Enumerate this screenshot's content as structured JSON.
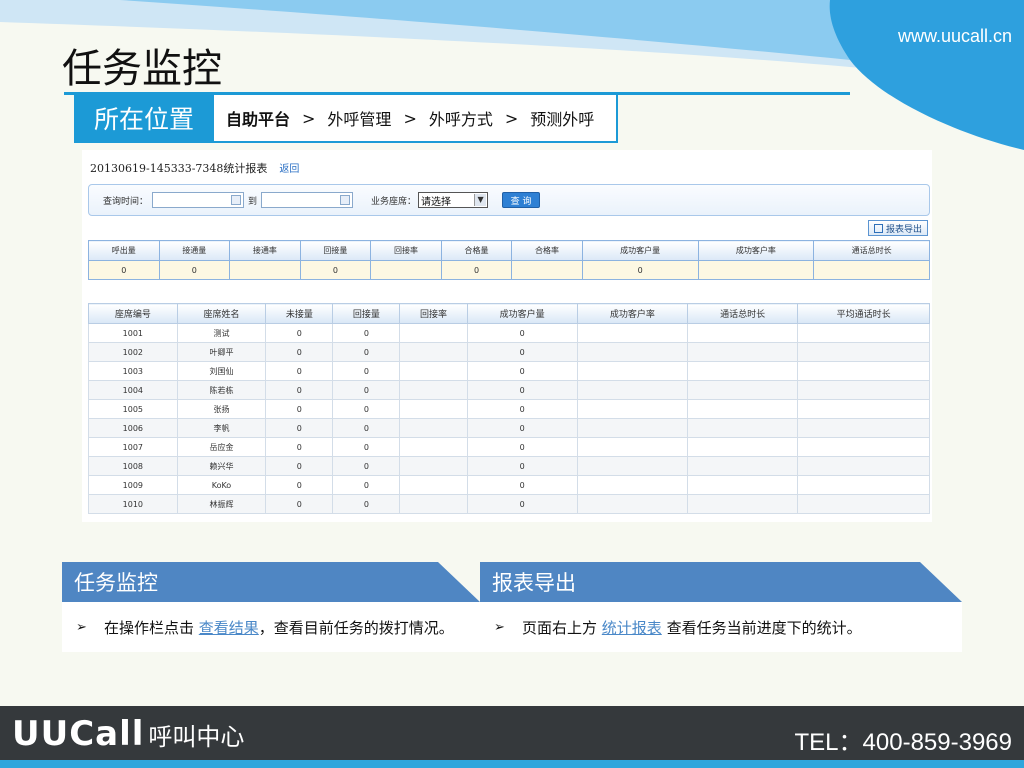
{
  "header": {
    "site_url": "www.uucall.cn",
    "page_title": "任务监控"
  },
  "location": {
    "label": "所在位置",
    "crumbs": [
      "自助平台",
      "外呼管理",
      "外呼方式",
      "预测外呼"
    ],
    "separator": ">"
  },
  "report": {
    "title": "20130619-145333-7348统计报表",
    "back_label": "返回",
    "query": {
      "time_label": "查询时间：",
      "to_label": "到",
      "agent_label": "业务座席：",
      "agent_select": "请选择",
      "query_button": "查 询"
    },
    "export_button": "报表导出",
    "summary": {
      "headers": [
        "呼出量",
        "接通量",
        "接通率",
        "回接量",
        "回接率",
        "合格量",
        "合格率",
        "成功客户量",
        "成功客户率",
        "通话总时长"
      ],
      "row": [
        "0",
        "0",
        "",
        "0",
        "",
        "0",
        "",
        "0",
        "",
        ""
      ]
    },
    "agents": {
      "headers": [
        "座席编号",
        "座席姓名",
        "未接量",
        "回接量",
        "回接率",
        "成功客户量",
        "成功客户率",
        "通话总时长",
        "平均通话时长"
      ],
      "rows": [
        [
          "1001",
          "测试",
          "0",
          "0",
          "",
          "0",
          "",
          "",
          ""
        ],
        [
          "1002",
          "叶卿平",
          "0",
          "0",
          "",
          "0",
          "",
          "",
          ""
        ],
        [
          "1003",
          "刘国仙",
          "0",
          "0",
          "",
          "0",
          "",
          "",
          ""
        ],
        [
          "1004",
          "陈若栋",
          "0",
          "0",
          "",
          "0",
          "",
          "",
          ""
        ],
        [
          "1005",
          "张扬",
          "0",
          "0",
          "",
          "0",
          "",
          "",
          ""
        ],
        [
          "1006",
          "李帆",
          "0",
          "0",
          "",
          "0",
          "",
          "",
          ""
        ],
        [
          "1007",
          "岳应金",
          "0",
          "0",
          "",
          "0",
          "",
          "",
          ""
        ],
        [
          "1008",
          "赖兴华",
          "0",
          "0",
          "",
          "0",
          "",
          "",
          ""
        ],
        [
          "1009",
          "KoKo",
          "0",
          "0",
          "",
          "0",
          "",
          "",
          ""
        ],
        [
          "1010",
          "林振辉",
          "0",
          "0",
          "",
          "0",
          "",
          "",
          ""
        ]
      ]
    }
  },
  "info_left": {
    "title": "任务监控",
    "bullet": "➢",
    "text_before": "在操作栏点击 ",
    "link": "查看结果",
    "text_after": "，查看目前任务的拨打情况。"
  },
  "info_right": {
    "title": "报表导出",
    "bullet": "➢",
    "text_before": "页面右上方 ",
    "link": "统计报表",
    "text_after": " 查看任务当前进度下的统计。"
  },
  "footer": {
    "brand_main": "UUCall",
    "brand_sub": "呼叫中心",
    "tel": "TEL：400-859-3969"
  },
  "colors": {
    "accent": "#1c9ad6",
    "info_header": "#4f86c3",
    "footer_bg": "#35393c",
    "link": "#4a88c8"
  }
}
